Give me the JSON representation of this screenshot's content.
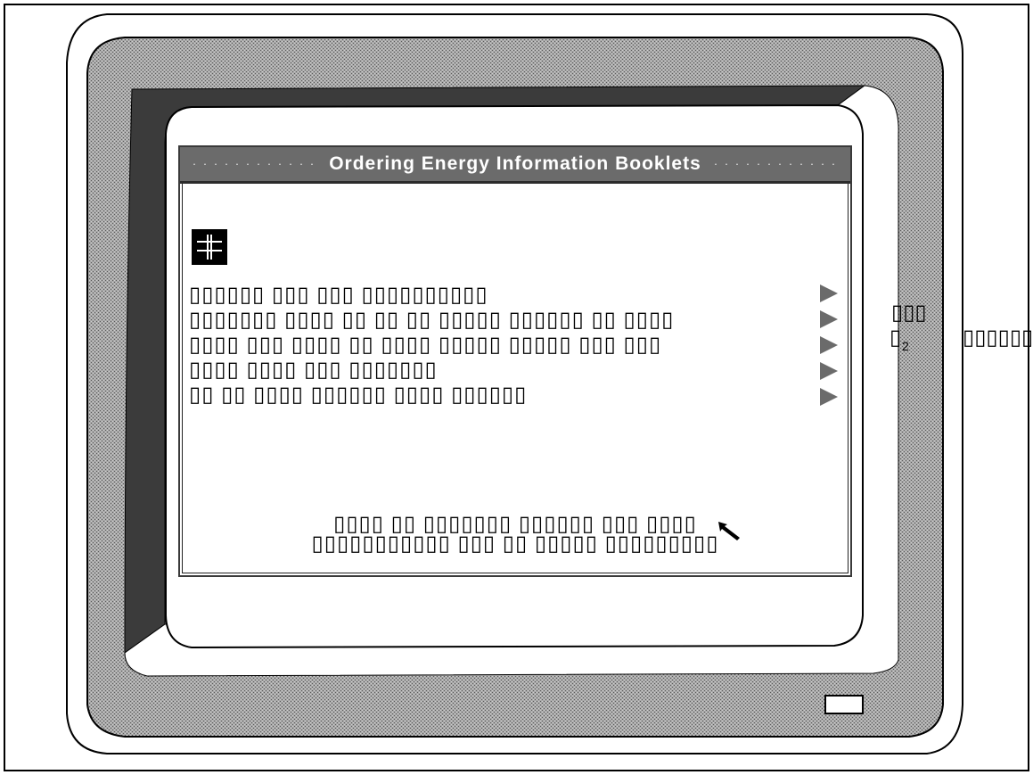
{
  "window": {
    "title": "Ordering Energy Information Booklets"
  },
  "app_icon": "clipboard-icon",
  "menu": {
    "lines": [
      "▯▯▯▯▯▯ ▯▯▯ ▯▯▯ ▯▯▯▯▯▯▯▯▯▯",
      "▯▯▯▯▯▯▯ ▯▯▯▯ ▯▯ ▯▯ ▯▯ ▯▯▯▯▯ ▯▯▯▯▯▯ ▯▯ ▯▯▯▯",
      "▯▯▯▯ ▯▯▯ ▯▯▯▯ ▯▯ ▯▯▯▯ ▯▯▯▯▯ ▯▯▯▯▯ ▯▯▯ ▯▯▯",
      "▯▯▯▯ ▯▯▯▯ ▯▯▯ ▯▯▯▯▯▯▯",
      "▯▯ ▯▯ ▯▯▯▯ ▯▯▯▯▯▯ ▯▯▯▯ ▯▯▯▯▯▯"
    ],
    "overflow_right": [
      "▯▯▯",
      "▯",
      "▯▯▯▯▯▯"
    ],
    "subscript": "2"
  },
  "prompt": {
    "line1": "▯▯▯▯ ▯▯ ▯▯▯▯▯▯▯ ▯▯▯▯▯▯ ▯▯▯ ▯▯▯▯",
    "line2": "▯▯▯▯▯▯▯▯▯▯▯ ▯▯▯ ▯▯ ▯▯▯▯▯ ▯▯▯▯▯▯▯▯▯"
  },
  "colors": {
    "bezel": "#8a8a8a",
    "bezel_dark": "#3b3b3b",
    "titlebar": "#6b6b6b",
    "arrow": "#6b6b6b"
  }
}
